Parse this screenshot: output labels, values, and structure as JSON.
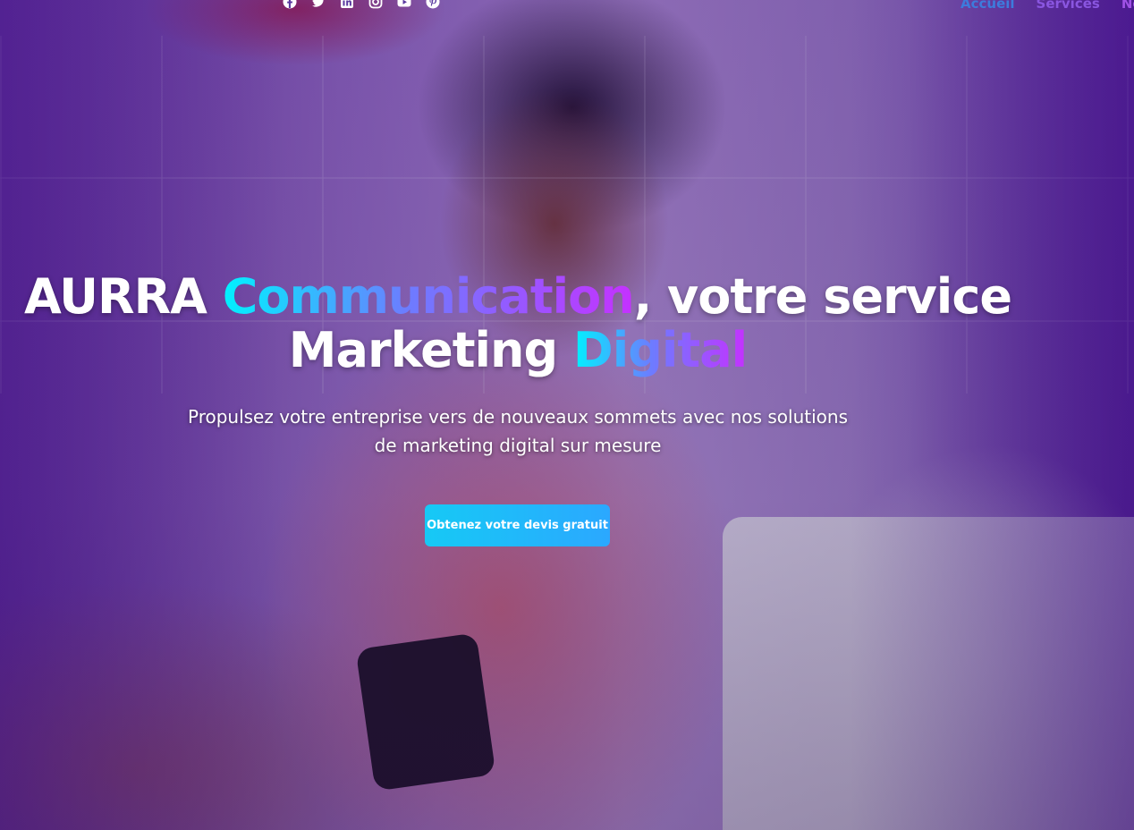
{
  "social": [
    {
      "icon": "facebook-icon"
    },
    {
      "icon": "twitter-icon"
    },
    {
      "icon": "linkedin-icon"
    },
    {
      "icon": "instagram-icon"
    },
    {
      "icon": "youtube-icon"
    },
    {
      "icon": "pinterest-icon"
    }
  ],
  "nav": {
    "items": [
      {
        "label": "Accueil"
      },
      {
        "label": "Services"
      },
      {
        "label": "Nos"
      }
    ]
  },
  "hero": {
    "title_part1": "AURRA ",
    "title_highlight1": "Communication",
    "title_part2": ", votre service",
    "title_part3": "Marketing ",
    "title_highlight2": "Digital",
    "subtitle": "Propulsez votre entreprise vers de nouveaux sommets avec nos solutions de marketing digital sur mesure",
    "cta_label": "Obtenez votre devis gratuit"
  },
  "colors": {
    "accent_gradient_start": "#00f2ff",
    "accent_gradient_end": "#c531ff",
    "cta_start": "#16c9f5",
    "cta_end": "#2ba8ff",
    "nav_active": "#3d7bdc"
  }
}
